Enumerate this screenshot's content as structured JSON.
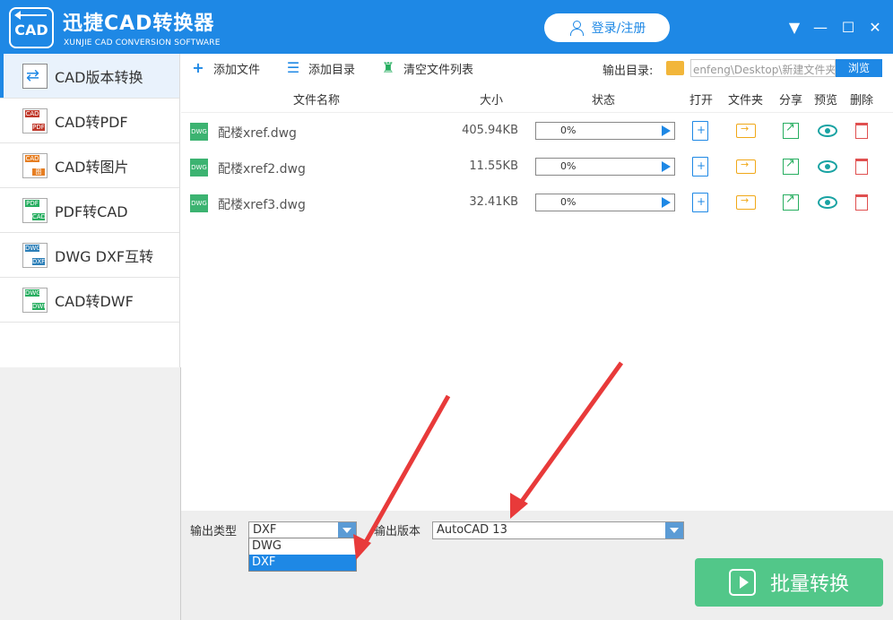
{
  "titlebar": {
    "logo_text": "CAD",
    "title": "迅捷CAD转换器",
    "subtitle": "XUNJIE CAD CONVERSION SOFTWARE",
    "login_label": "登录/注册",
    "min_symbol": "—",
    "max_symbol": "☐",
    "close_symbol": "✕",
    "menu_symbol": "▼"
  },
  "sidebar": {
    "items": [
      {
        "label": "CAD版本转换"
      },
      {
        "label": "CAD转PDF",
        "icon_top": "CAD",
        "icon_bot": "PDF"
      },
      {
        "label": "CAD转图片",
        "icon_top": "CAD",
        "icon_bot": "图"
      },
      {
        "label": "PDF转CAD",
        "icon_top": "PDF",
        "icon_bot": "CAD"
      },
      {
        "label": "DWG DXF互转",
        "icon_top": "DWG",
        "icon_bot": "DXF"
      },
      {
        "label": "CAD转DWF",
        "icon_top": "DWG",
        "icon_bot": "DWF"
      }
    ]
  },
  "toolbar": {
    "add_file": "添加文件",
    "add_dir": "添加目录",
    "clear_list": "清空文件列表",
    "output_dir_label": "输出目录:",
    "output_path": "enfeng\\Desktop\\新建文件夹",
    "browse": "浏览"
  },
  "table": {
    "headers": {
      "name": "文件名称",
      "size": "大小",
      "status": "状态",
      "open": "打开",
      "folder": "文件夹",
      "share": "分享",
      "preview": "预览",
      "delete": "删除"
    },
    "file_icon_text": "DWG",
    "rows": [
      {
        "name": "配楼xref.dwg",
        "size": "405.94KB",
        "progress": "0%"
      },
      {
        "name": "配楼xref2.dwg",
        "size": "11.55KB",
        "progress": "0%"
      },
      {
        "name": "配楼xref3.dwg",
        "size": "32.41KB",
        "progress": "0%"
      }
    ]
  },
  "settings": {
    "output_type_label": "输出类型",
    "output_type_value": "DXF",
    "output_type_options": [
      "DWG",
      "DXF"
    ],
    "output_version_label": "输出版本",
    "output_version_value": "AutoCAD 13"
  },
  "batch_button": "批量转换",
  "colors": {
    "brand": "#1e88e5",
    "batch_green": "#52c789",
    "annotation_red": "#e83a3a"
  }
}
